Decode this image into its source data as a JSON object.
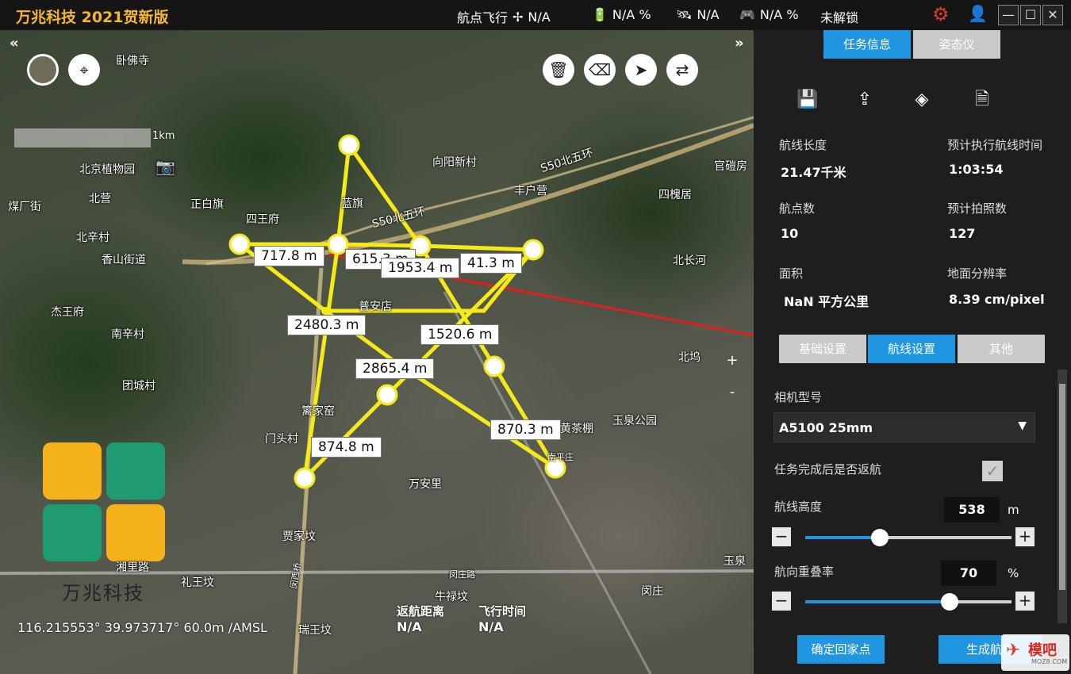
{
  "app": {
    "title": "万兆科技 2021贺新版"
  },
  "status_bar": {
    "flight_mode_label": "航点飞行",
    "flight_mode_value": "N/A",
    "battery_value": "N/A %",
    "satellite_value": "N/A",
    "rc_value": "N/A %",
    "lock_state": "未解锁"
  },
  "window": {
    "minimize": "—",
    "maximize": "☐",
    "close": "✕"
  },
  "map": {
    "nav_left": "«",
    "nav_right": "»",
    "scale_label": "1km",
    "place_labels": [
      {
        "text": "卧佛寺"
      },
      {
        "text": "北京植物园"
      },
      {
        "text": "北营"
      },
      {
        "text": "煤厂街"
      },
      {
        "text": "正白旗"
      },
      {
        "text": "北辛村"
      },
      {
        "text": "四王府"
      },
      {
        "text": "香山街道"
      },
      {
        "text": "杰王府"
      },
      {
        "text": "南辛村"
      },
      {
        "text": "团城村"
      },
      {
        "text": "向阳新村"
      },
      {
        "text": "丰户营"
      },
      {
        "text": "S50北五环"
      },
      {
        "text": "S50北五环"
      },
      {
        "text": "四槐居"
      },
      {
        "text": "官磑房"
      },
      {
        "text": "北长河"
      },
      {
        "text": "普安店"
      },
      {
        "text": "北坞"
      },
      {
        "text": "玉泉公园"
      },
      {
        "text": "篱家窑"
      },
      {
        "text": "门头村"
      },
      {
        "text": "万安里"
      },
      {
        "text": "贾家坟"
      },
      {
        "text": "礼王坟"
      },
      {
        "text": "闵庄路"
      },
      {
        "text": "牛禄坟"
      },
      {
        "text": "瑞王坟"
      },
      {
        "text": "闵庄"
      },
      {
        "text": "湘里路"
      },
      {
        "text": "闵西桥"
      },
      {
        "text": "黄茶棚"
      },
      {
        "text": "南平庄"
      },
      {
        "text": "玉泉"
      },
      {
        "text": "蓝旗"
      }
    ],
    "distance_labels": [
      {
        "text": "717.8 m"
      },
      {
        "text": "615.3 m"
      },
      {
        "text": "1953.4 m"
      },
      {
        "text": "41.3 m"
      },
      {
        "text": "2480.3 m"
      },
      {
        "text": "1520.6 m"
      },
      {
        "text": "2865.4 m"
      },
      {
        "text": "870.3 m"
      },
      {
        "text": "874.8 m"
      }
    ],
    "zoom_in": "+",
    "zoom_out": "-",
    "return_distance_label": "返航距离",
    "return_distance_value": "N/A",
    "flight_time_label": "飞行时间",
    "flight_time_value": "N/A",
    "coords": "116.215553° 39.973717° 60.0m /AMSL",
    "logo_text": "万兆科技"
  },
  "panel": {
    "tabs_top": [
      {
        "label": "任务信息",
        "active": true
      },
      {
        "label": "姿态仪",
        "active": false
      }
    ],
    "tools": [
      {
        "icon": "save-icon",
        "glyph": "💾"
      },
      {
        "icon": "export-icon",
        "glyph": "⇪"
      },
      {
        "icon": "camera-survey-icon",
        "glyph": "◈"
      },
      {
        "icon": "kml-icon",
        "glyph": "🗎"
      }
    ],
    "info": {
      "route_length_label": "航线长度",
      "route_length_value": "21.47千米",
      "est_time_label": "预计执行航线时间",
      "est_time_value": "1:03:54",
      "waypoints_label": "航点数",
      "waypoints_value": "10",
      "est_photos_label": "预计拍照数",
      "est_photos_value": "127",
      "area_label": "面积",
      "area_value": "NaN 平方公里",
      "gsd_label": "地面分辨率",
      "gsd_value": "8.39 cm/pixel"
    },
    "tabs_settings": [
      {
        "label": "基础设置",
        "active": false
      },
      {
        "label": "航线设置",
        "active": true
      },
      {
        "label": "其他",
        "active": false
      }
    ],
    "camera_label": "相机型号",
    "camera_value": "A5100 25mm",
    "return_label": "任务完成后是否返航",
    "return_checked": true,
    "altitude_label": "航线高度",
    "altitude_value": "538",
    "altitude_unit": "m",
    "altitude_fraction": 0.36,
    "overlap_label": "航向重叠率",
    "overlap_value": "70",
    "overlap_unit": "%",
    "overlap_fraction": 0.7,
    "btn_home": "确定回家点",
    "btn_generate": "生成航线"
  },
  "watermark": {
    "text": "模吧",
    "sub": "MOZ8.COM"
  },
  "colors": {
    "accent": "#2196e0",
    "route": "#ffee00",
    "title": "#f5b82a"
  }
}
